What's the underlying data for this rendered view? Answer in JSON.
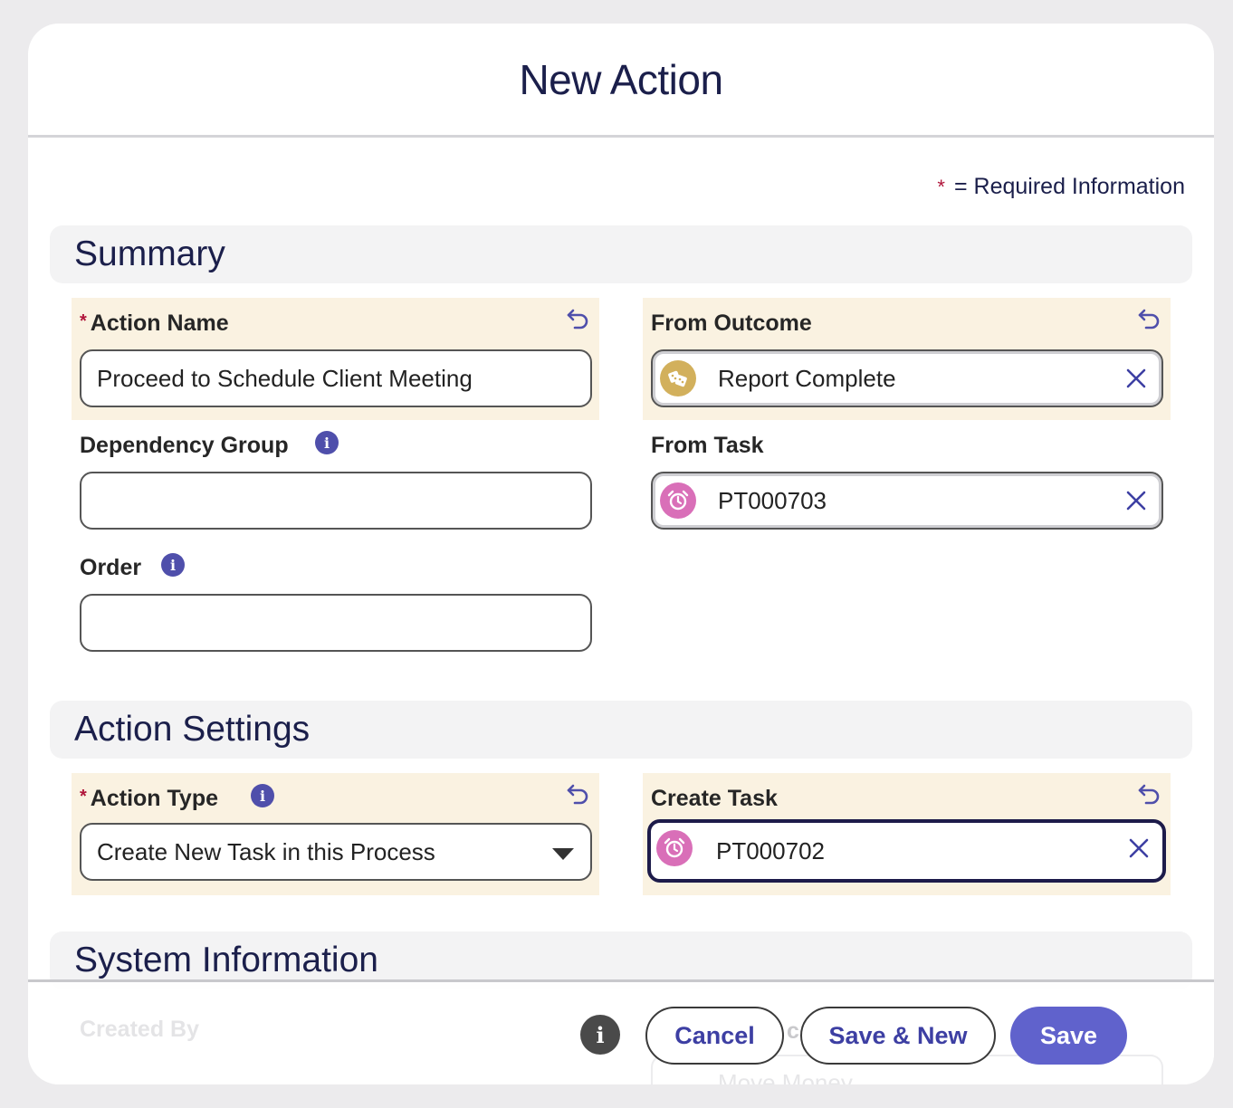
{
  "modal": {
    "title": "New Action"
  },
  "required_note": {
    "star": "*",
    "text": "= Required Information"
  },
  "sections": {
    "summary": "Summary",
    "action_settings": "Action Settings",
    "system_information": "System Information"
  },
  "fields": {
    "action_name": {
      "required": "*",
      "label": "Action Name",
      "value": "Proceed to Schedule Client Meeting"
    },
    "dependency_group": {
      "label": "Dependency Group",
      "value": ""
    },
    "order": {
      "label": "Order",
      "value": ""
    },
    "from_outcome": {
      "label": "From Outcome",
      "value": "Report Complete",
      "icon": "dice-icon"
    },
    "from_task": {
      "label": "From Task",
      "value": "PT000703",
      "icon": "alarm-clock-icon"
    },
    "action_type": {
      "required": "*",
      "label": "Action Type",
      "value": "Create New Task in this Process"
    },
    "create_task": {
      "label": "Create Task",
      "value": "PT000702",
      "icon": "alarm-clock-icon"
    }
  },
  "system_info": {
    "created_by_label": "Created By",
    "partial_label": "c",
    "move_money": "Move Money"
  },
  "info_glyph": "i",
  "footer": {
    "cancel": "Cancel",
    "save_new": "Save & New",
    "save": "Save"
  },
  "colors": {
    "accent": "#6062cc",
    "edited_bg": "#faf2e1",
    "required": "#b0153a",
    "outcome_badge": "#d2b05c",
    "task_badge": "#d96fb8"
  }
}
